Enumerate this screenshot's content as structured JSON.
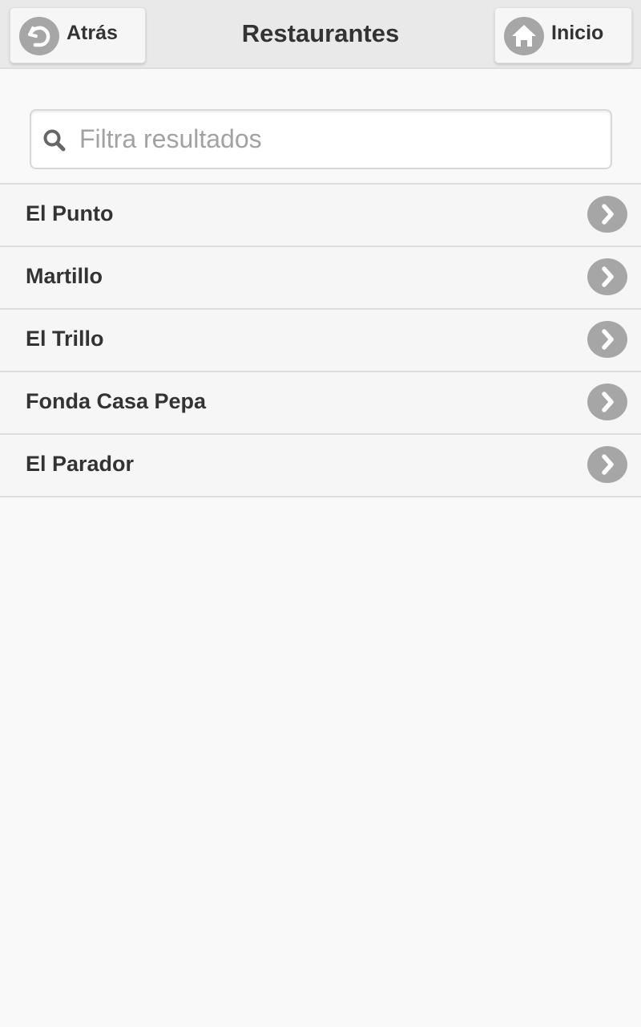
{
  "header": {
    "title": "Restaurantes",
    "back_label": "Atrás",
    "back_icon": "back-arrow-icon",
    "home_label": "Inicio",
    "home_icon": "home-icon"
  },
  "search": {
    "placeholder": "Filtra resultados",
    "value": "",
    "icon": "search-icon"
  },
  "restaurants": [
    {
      "label": "El Punto",
      "icon": "chevron-right-icon"
    },
    {
      "label": "Martillo",
      "icon": "chevron-right-icon"
    },
    {
      "label": "El Trillo",
      "icon": "chevron-right-icon"
    },
    {
      "label": "Fonda Casa Pepa",
      "icon": "chevron-right-icon"
    },
    {
      "label": "El Parador",
      "icon": "chevron-right-icon"
    }
  ],
  "colors": {
    "header_bg": "#e9e9e9",
    "page_bg": "#f9f9f9",
    "list_item_bg": "#f6f6f6",
    "icon_circle": "#a6a6a6",
    "text": "#333333",
    "placeholder": "#a2a2a2"
  }
}
